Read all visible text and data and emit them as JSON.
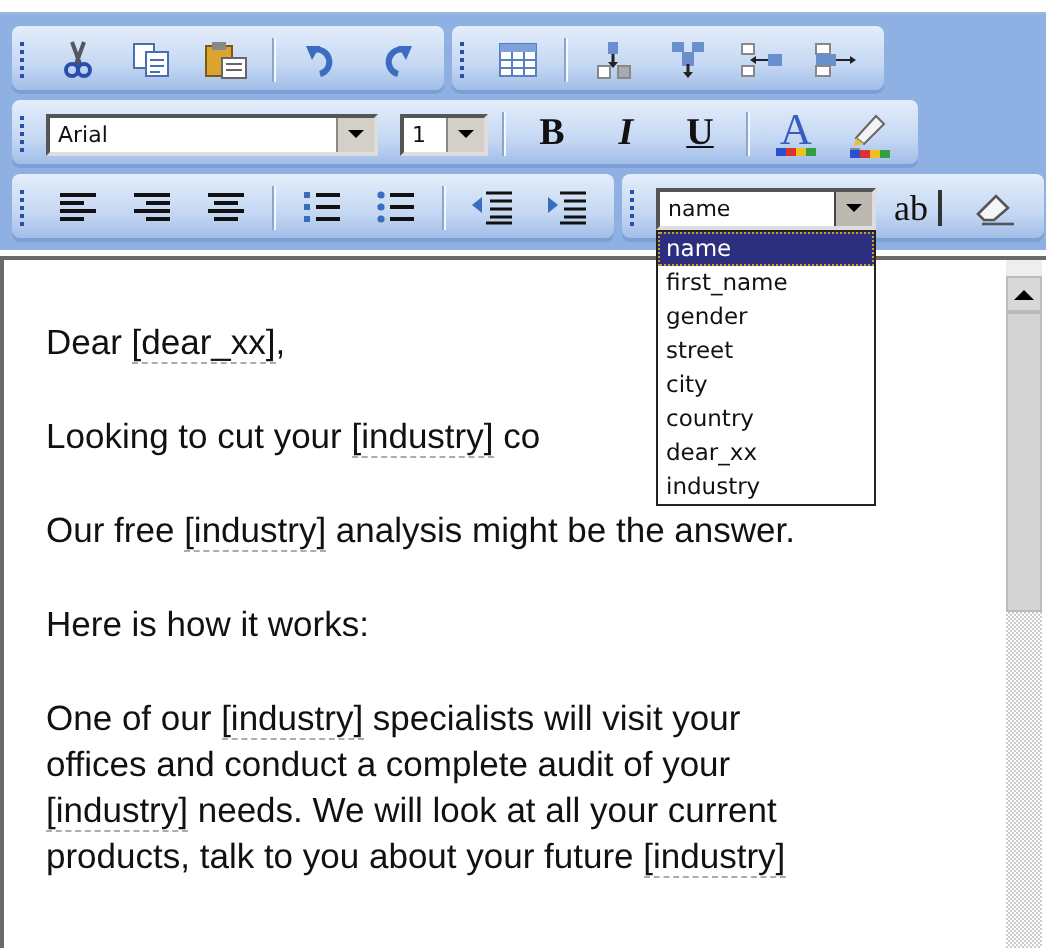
{
  "toolbar": {
    "font": "Arial",
    "size": "1",
    "bold": "B",
    "italic": "I",
    "underline": "U",
    "font_color": "A",
    "insert_field": "ab",
    "field_select": {
      "value": "name",
      "expanded": true,
      "options": [
        {
          "label": "name",
          "selected": true
        },
        {
          "label": "first_name",
          "selected": false
        },
        {
          "label": "gender",
          "selected": false
        },
        {
          "label": "street",
          "selected": false
        },
        {
          "label": "city",
          "selected": false
        },
        {
          "label": "country",
          "selected": false
        },
        {
          "label": "dear_xx",
          "selected": false
        },
        {
          "label": "industry",
          "selected": false
        }
      ]
    }
  },
  "document": {
    "paragraphs": [
      [
        [
          {
            "kind": "text",
            "text": "Dear "
          },
          {
            "kind": "field",
            "text": "[dear_xx]"
          },
          {
            "kind": "text",
            "text": ","
          }
        ]
      ],
      [
        [
          {
            "kind": "text",
            "text": "Looking to cut your "
          },
          {
            "kind": "field",
            "text": "[industry]"
          },
          {
            "kind": "text",
            "text": " co"
          }
        ]
      ],
      [
        [
          {
            "kind": "text",
            "text": "Our free "
          },
          {
            "kind": "field",
            "text": "[industry]"
          },
          {
            "kind": "text",
            "text": " analysis might be the answer."
          }
        ]
      ],
      [
        [
          {
            "kind": "text",
            "text": "Here is how it works:"
          }
        ]
      ],
      [
        [
          {
            "kind": "text",
            "text": "One of our "
          },
          {
            "kind": "field",
            "text": "[industry]"
          },
          {
            "kind": "text",
            "text": " specialists will visit your"
          }
        ],
        [
          {
            "kind": "text",
            "text": "offices and conduct a complete audit of your"
          }
        ],
        [
          {
            "kind": "field",
            "text": "[industry]"
          },
          {
            "kind": "text",
            "text": " needs. We will look at all your current"
          }
        ],
        [
          {
            "kind": "text",
            "text": "products, talk to you about your future "
          },
          {
            "kind": "field",
            "text": "[industry]"
          }
        ]
      ]
    ]
  }
}
